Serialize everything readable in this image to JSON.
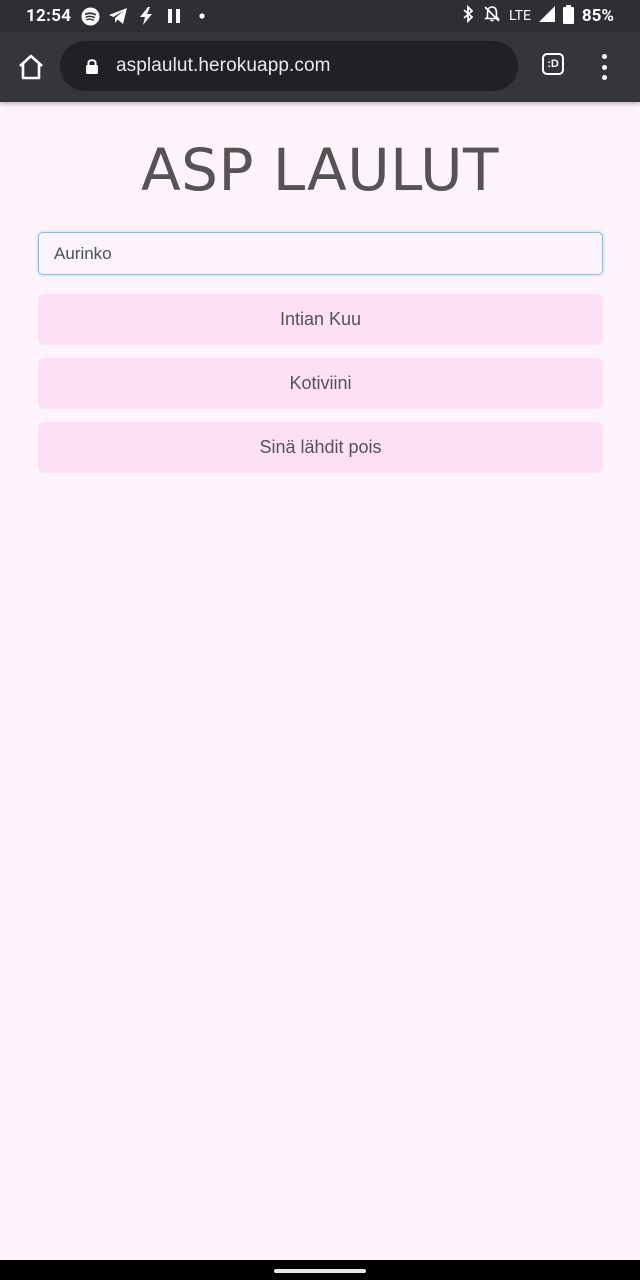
{
  "status_bar": {
    "time": "12:54",
    "network": "LTE",
    "battery": "85%"
  },
  "browser": {
    "url": "asplaulut.herokuapp.com",
    "tab_switcher_label": ":D"
  },
  "page": {
    "title": "ASP LAULUT",
    "search": {
      "value": "Aurinko"
    },
    "songs": [
      {
        "label": "Intian Kuu"
      },
      {
        "label": "Kotiviini"
      },
      {
        "label": "Sinä lähdit pois"
      }
    ]
  },
  "colors": {
    "page_background": "#fdf3fb",
    "song_item_background": "#fde0f5",
    "text": "#555353",
    "input_focus_border": "#80bdff"
  },
  "icons": [
    "spotify-icon",
    "telegram-icon",
    "bolt-icon",
    "pause-icon",
    "dot-icon",
    "bluetooth-icon",
    "bell-off-icon",
    "signal-icon",
    "battery-icon",
    "home-icon",
    "lock-icon",
    "tab-switcher-icon",
    "more-vert-icon"
  ]
}
